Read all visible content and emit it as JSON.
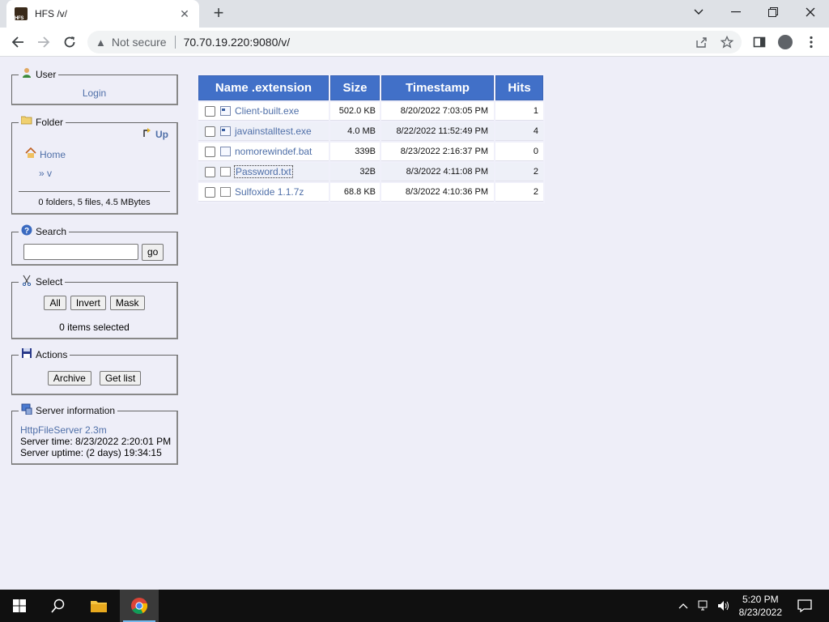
{
  "browser": {
    "tab_title": "HFS /v/",
    "not_secure": "Not secure",
    "url": "70.70.19.220:9080/v/"
  },
  "user": {
    "legend": "User",
    "login": "Login"
  },
  "folder": {
    "legend": "Folder",
    "up": "Up",
    "home": "Home",
    "current": "» v",
    "summary": "0 folders, 5 files, 4.5 MBytes"
  },
  "search": {
    "legend": "Search",
    "go": "go",
    "value": ""
  },
  "select": {
    "legend": "Select",
    "all": "All",
    "invert": "Invert",
    "mask": "Mask",
    "status": "0 items selected"
  },
  "actions": {
    "legend": "Actions",
    "archive": "Archive",
    "get_list": "Get list"
  },
  "server": {
    "legend": "Server information",
    "software": "HttpFileServer 2.3m",
    "time": "Server time: 8/23/2022 2:20:01 PM",
    "uptime": "Server uptime: (2 days) 19:34:15"
  },
  "table": {
    "headers": [
      "Name .extension",
      "Size",
      "Timestamp",
      "Hits"
    ],
    "rows": [
      {
        "name": "Client-built.exe",
        "size": "502.0 KB",
        "timestamp": "8/20/2022 7:03:05 PM",
        "hits": "1",
        "icon": "exe-icon"
      },
      {
        "name": "javainstalltest.exe",
        "size": "4.0 MB",
        "timestamp": "8/22/2022 11:52:49 PM",
        "hits": "4",
        "icon": "exe-icon"
      },
      {
        "name": "nomorewindef.bat",
        "size": "339B",
        "timestamp": "8/23/2022 2:16:37 PM",
        "hits": "0",
        "icon": "bat-icon"
      },
      {
        "name": "Password.txt",
        "size": "32B",
        "timestamp": "8/3/2022 4:11:08 PM",
        "hits": "2",
        "icon": "txt-icon"
      },
      {
        "name": "Sulfoxide 1.1.7z",
        "size": "68.8 KB",
        "timestamp": "8/3/2022 4:10:36 PM",
        "hits": "2",
        "icon": "file-icon"
      }
    ]
  },
  "taskbar": {
    "time": "5:20 PM",
    "date": "8/23/2022"
  },
  "colors": {
    "header_blue": "#4170c8",
    "link_blue": "#4f6fa8",
    "page_bg": "#eeeef8"
  }
}
